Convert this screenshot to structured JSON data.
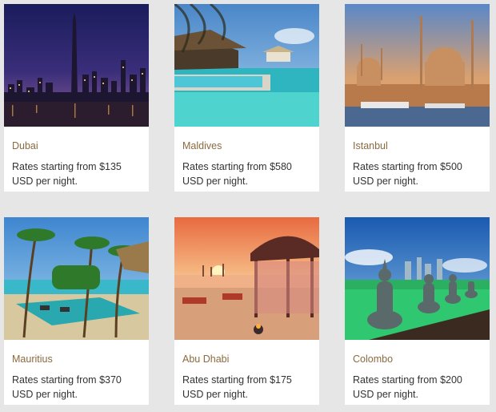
{
  "destinations": [
    {
      "city": "Dubai",
      "rate": "Rates starting from $135 USD per night."
    },
    {
      "city": "Maldives",
      "rate": "Rates starting from $580 USD per night."
    },
    {
      "city": "Istanbul",
      "rate": "Rates starting from $500 USD per night."
    },
    {
      "city": "Mauritius",
      "rate": "Rates starting from $370 USD per night."
    },
    {
      "city": "Abu Dhabi",
      "rate": "Rates starting from $175 USD per night."
    },
    {
      "city": "Colombo",
      "rate": "Rates starting from $200 USD per night."
    }
  ],
  "colors": {
    "background": "#e6e6e6",
    "card": "#ffffff",
    "city_text": "#8a6a3f",
    "rate_text": "#333333"
  }
}
